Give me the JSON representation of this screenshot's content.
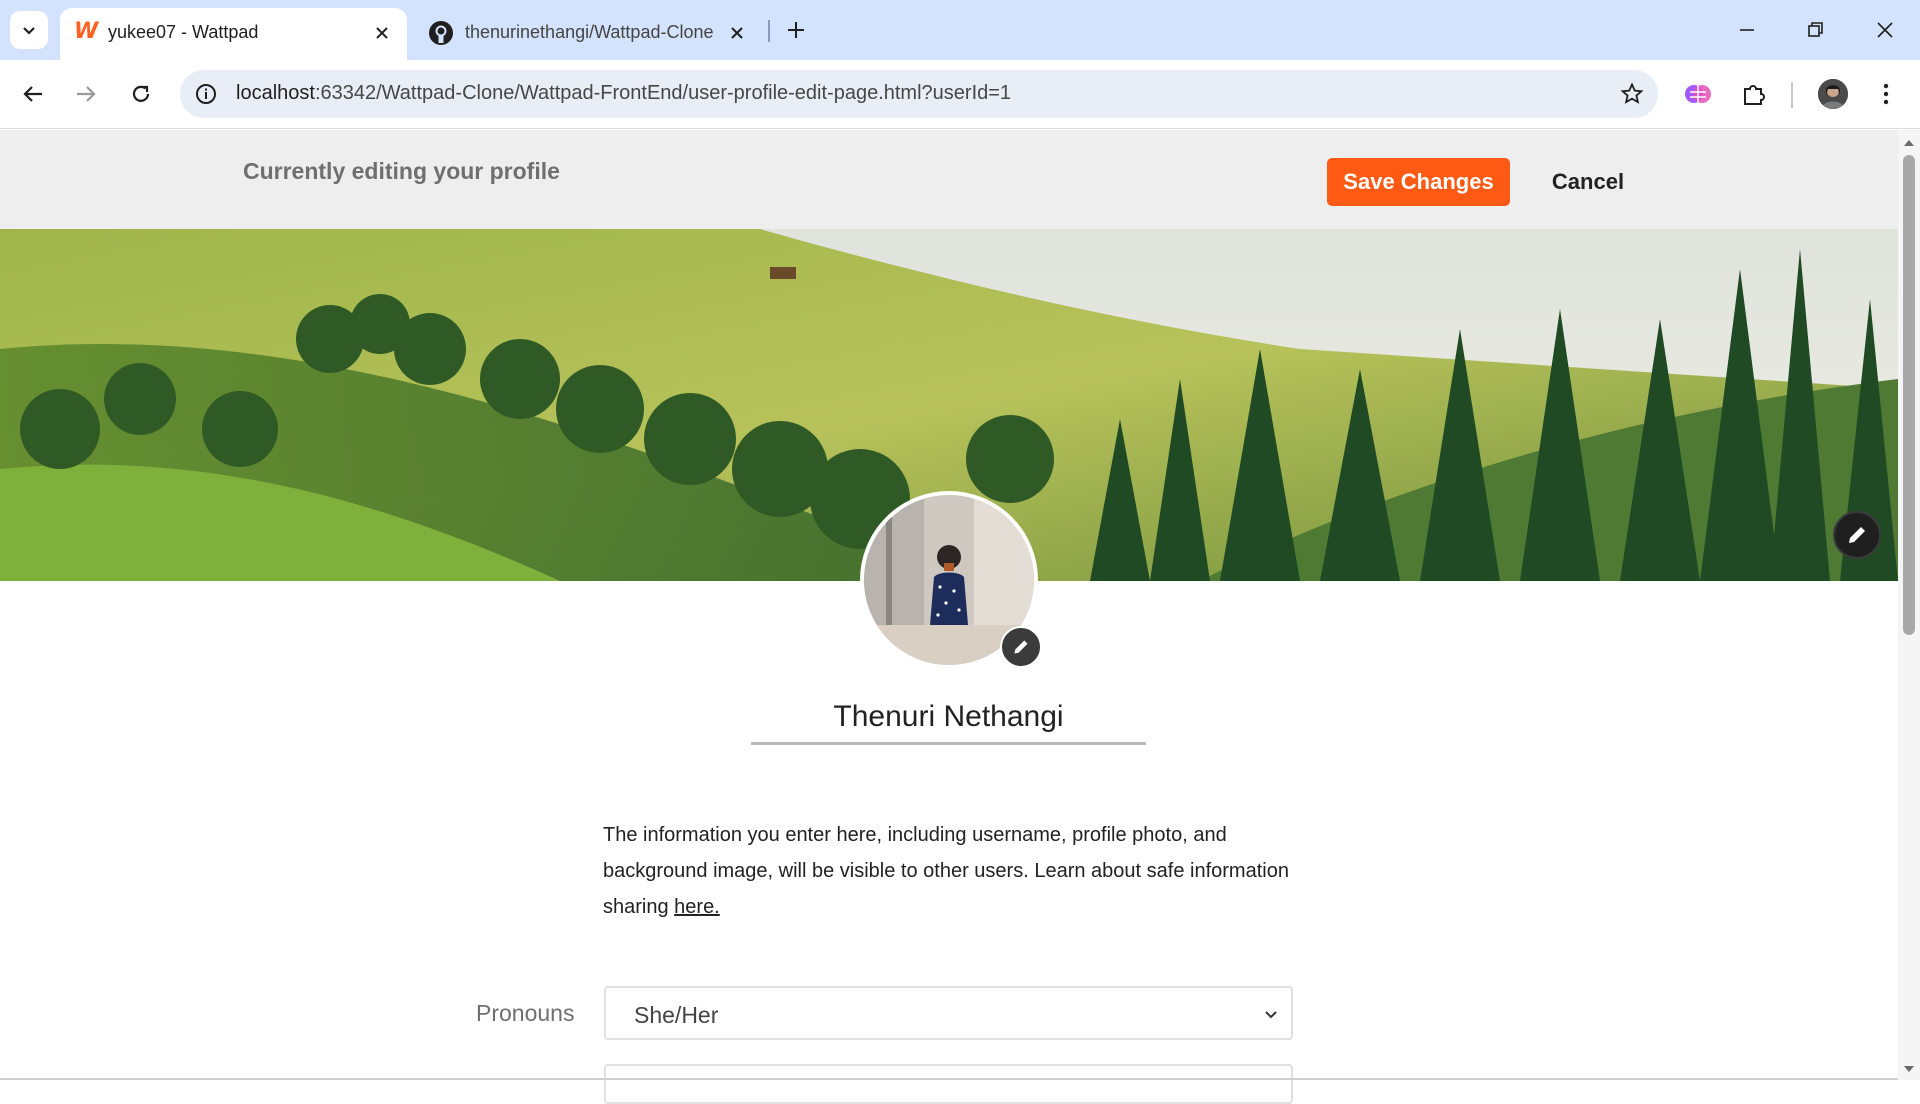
{
  "browser": {
    "tabs": [
      {
        "title": "yukee07 - Wattpad",
        "active": true,
        "favicon": "wattpad-w-icon"
      },
      {
        "title": "thenurinethangi/Wattpad-Clone",
        "active": false,
        "favicon": "github-icon"
      }
    ],
    "url_host": "localhost",
    "url_rest": ":63342/Wattpad-Clone/Wattpad-FrontEnd/user-profile-edit-page.html?userId=1"
  },
  "edit_bar": {
    "title": "Currently editing your profile",
    "save_label": "Save Changes",
    "cancel_label": "Cancel"
  },
  "profile": {
    "display_name": "Thenuri Nethangi"
  },
  "info": {
    "text": "The information you enter here, including username, profile photo, and background image, will be visible to other users. Learn about safe information sharing ",
    "link_text": "here."
  },
  "form": {
    "pronouns_label": "Pronouns",
    "pronouns_value": "She/Her"
  },
  "colors": {
    "accent": "#ff5a14",
    "tabbar": "#d3e3fd"
  }
}
